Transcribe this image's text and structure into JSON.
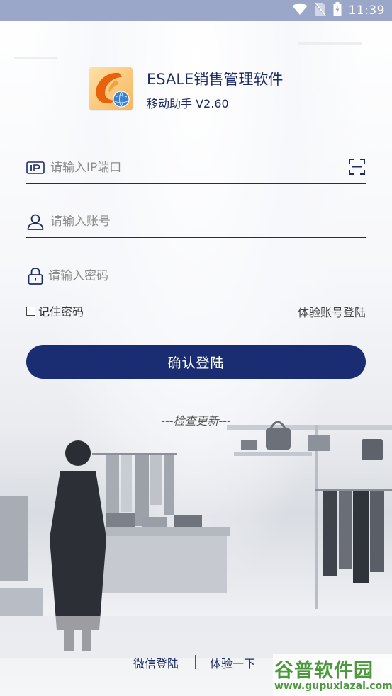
{
  "status_bar": {
    "time": "11:39",
    "icons": [
      "wifi-icon",
      "no-sim-icon",
      "battery-charging-icon"
    ],
    "background_color": "#9aa7c9"
  },
  "header": {
    "logo": "esale-logo",
    "title": "ESALE销售管理软件",
    "version": "移动助手 V2.60"
  },
  "form": {
    "ip": {
      "placeholder": "请输入IP端口",
      "value": "",
      "icon": "ip-icon",
      "action_icon": "scan-icon"
    },
    "username": {
      "placeholder": "请输入账号",
      "value": "",
      "icon": "user-icon"
    },
    "password": {
      "placeholder": "请输入密码",
      "value": "",
      "icon": "lock-icon"
    },
    "remember_label": "记住密码",
    "remember_checked": false,
    "trial_account_label": "体验账号登陆"
  },
  "login_button_label": "确认登陆",
  "check_update_label": "---检查更新---",
  "bottom": {
    "wechat_login_label": "微信登陆",
    "try_label": "体验一下"
  },
  "watermark": {
    "title": "谷普软件园",
    "url": "www.gupuxiazai.com"
  },
  "colors": {
    "primary": "#1a2d72",
    "text_dark": "#1d2c63",
    "watermark_green": "#4a9a3c"
  }
}
